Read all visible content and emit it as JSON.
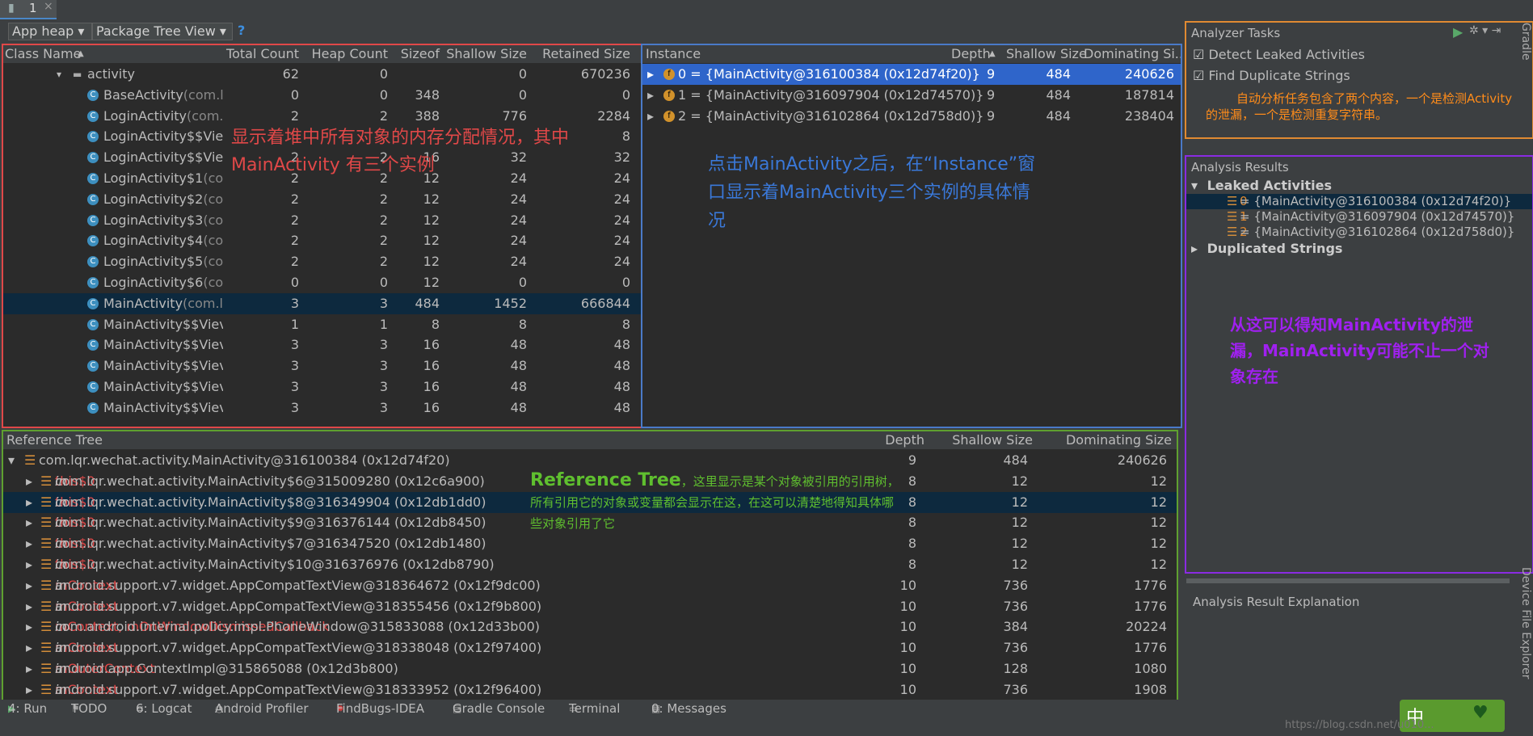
{
  "tab": {
    "label": "1",
    "close": "×"
  },
  "toolbar": {
    "heap": "App heap",
    "view": "Package Tree View",
    "help": "?"
  },
  "class_table": {
    "headers": [
      "Class Name",
      "Total Count",
      "Heap Count",
      "Sizeof",
      "Shallow Size",
      "Retained Size"
    ],
    "rows": [
      {
        "name": "activity",
        "pkg": "",
        "total": "62",
        "heap": "0",
        "sizeof": "",
        "shallow": "0",
        "retained": "670236"
      },
      {
        "name": "BaseActivity",
        "pkg": "(com.l",
        "total": "0",
        "heap": "0",
        "sizeof": "348",
        "shallow": "0",
        "retained": "0"
      },
      {
        "name": "LoginActivity",
        "pkg": "(com.",
        "total": "2",
        "heap": "2",
        "sizeof": "388",
        "shallow": "776",
        "retained": "2284"
      },
      {
        "name": "LoginActivity$$Viev",
        "pkg": "",
        "total": "",
        "heap": "",
        "sizeof": "",
        "shallow": "",
        "retained": "8"
      },
      {
        "name": "LoginActivity$$Viev",
        "pkg": "",
        "total": "2",
        "heap": "2",
        "sizeof": "16",
        "shallow": "32",
        "retained": "32"
      },
      {
        "name": "LoginActivity$1",
        "pkg": "(co",
        "total": "2",
        "heap": "2",
        "sizeof": "12",
        "shallow": "24",
        "retained": "24"
      },
      {
        "name": "LoginActivity$2",
        "pkg": "(co",
        "total": "2",
        "heap": "2",
        "sizeof": "12",
        "shallow": "24",
        "retained": "24"
      },
      {
        "name": "LoginActivity$3",
        "pkg": "(co",
        "total": "2",
        "heap": "2",
        "sizeof": "12",
        "shallow": "24",
        "retained": "24"
      },
      {
        "name": "LoginActivity$4",
        "pkg": "(co",
        "total": "2",
        "heap": "2",
        "sizeof": "12",
        "shallow": "24",
        "retained": "24"
      },
      {
        "name": "LoginActivity$5",
        "pkg": "(co",
        "total": "2",
        "heap": "2",
        "sizeof": "12",
        "shallow": "24",
        "retained": "24"
      },
      {
        "name": "LoginActivity$6",
        "pkg": "(co",
        "total": "0",
        "heap": "0",
        "sizeof": "12",
        "shallow": "0",
        "retained": "0"
      },
      {
        "name": "MainActivity",
        "pkg": "(com.l",
        "total": "3",
        "heap": "3",
        "sizeof": "484",
        "shallow": "1452",
        "retained": "666844"
      },
      {
        "name": "MainActivity$$Viev",
        "pkg": "",
        "total": "1",
        "heap": "1",
        "sizeof": "8",
        "shallow": "8",
        "retained": "8"
      },
      {
        "name": "MainActivity$$Viev",
        "pkg": "",
        "total": "3",
        "heap": "3",
        "sizeof": "16",
        "shallow": "48",
        "retained": "48"
      },
      {
        "name": "MainActivity$$Viev",
        "pkg": "",
        "total": "3",
        "heap": "3",
        "sizeof": "16",
        "shallow": "48",
        "retained": "48"
      },
      {
        "name": "MainActivity$$Viev",
        "pkg": "",
        "total": "3",
        "heap": "3",
        "sizeof": "16",
        "shallow": "48",
        "retained": "48"
      },
      {
        "name": "MainActivity$$Viev",
        "pkg": "",
        "total": "3",
        "heap": "3",
        "sizeof": "16",
        "shallow": "48",
        "retained": "48"
      }
    ]
  },
  "instance_table": {
    "headers": [
      "Instance",
      "Depth",
      "Shallow Size",
      "Dominating Si.."
    ],
    "rows": [
      {
        "label": "0 = {MainActivity@316100384 (0x12d74f20)}",
        "depth": "9",
        "shallow": "484",
        "dom": "240626"
      },
      {
        "label": "1 = {MainActivity@316097904 (0x12d74570)}",
        "depth": "9",
        "shallow": "484",
        "dom": "187814"
      },
      {
        "label": "2 = {MainActivity@316102864 (0x12d758d0)}",
        "depth": "9",
        "shallow": "484",
        "dom": "238404"
      }
    ]
  },
  "analyzer": {
    "title": "Analyzer Tasks",
    "tasks": [
      "Detect Leaked Activities",
      "Find Duplicate Strings"
    ],
    "results_title": "Analysis Results",
    "leaked_title": "Leaked Activities",
    "leaked": [
      "0 = {MainActivity@316100384 (0x12d74f20)}",
      "1 = {MainActivity@316097904 (0x12d74570)}",
      "2 = {MainActivity@316102864 (0x12d758d0)}"
    ],
    "duplicated_title": "Duplicated Strings",
    "explanation_title": "Analysis Result Explanation"
  },
  "reference_tree": {
    "headers": [
      "Reference Tree",
      "Depth",
      "Shallow Size",
      "Dominating Size"
    ],
    "rows": [
      {
        "field": "",
        "in": "",
        "obj": "com.lqr.wechat.activity.MainActivity@316100384 (0x12d74f20)",
        "depth": "9",
        "shallow": "484",
        "dom": "240626"
      },
      {
        "field": "this$0",
        "in": "in",
        "obj": "com.lqr.wechat.activity.MainActivity$6@315009280 (0x12c6a900)",
        "depth": "8",
        "shallow": "12",
        "dom": "12"
      },
      {
        "field": "this$0",
        "in": "in",
        "obj": "com.lqr.wechat.activity.MainActivity$8@316349904 (0x12db1dd0)",
        "depth": "8",
        "shallow": "12",
        "dom": "12"
      },
      {
        "field": "this$0",
        "in": "in",
        "obj": "com.lqr.wechat.activity.MainActivity$9@316376144 (0x12db8450)",
        "depth": "8",
        "shallow": "12",
        "dom": "12"
      },
      {
        "field": "this$0",
        "in": "in",
        "obj": "com.lqr.wechat.activity.MainActivity$7@316347520 (0x12db1480)",
        "depth": "8",
        "shallow": "12",
        "dom": "12"
      },
      {
        "field": "this$0",
        "in": "in",
        "obj": "com.lqr.wechat.activity.MainActivity$10@316376976 (0x12db8790)",
        "depth": "8",
        "shallow": "12",
        "dom": "12"
      },
      {
        "field": "mContext",
        "in": "in",
        "obj": "android.support.v7.widget.AppCompatTextView@318364672 (0x12f9dc00)",
        "depth": "10",
        "shallow": "736",
        "dom": "1776"
      },
      {
        "field": "mContext",
        "in": "in",
        "obj": "android.support.v7.widget.AppCompatTextView@318355456 (0x12f9b800)",
        "depth": "10",
        "shallow": "736",
        "dom": "1776"
      },
      {
        "field": "mContext, mOnWindowDismissedCallback",
        "in": "in",
        "obj": "com.android.internal.policy.impl.PhoneWindow@315833088 (0x12d33b00)",
        "depth": "10",
        "shallow": "384",
        "dom": "20224"
      },
      {
        "field": "mContext",
        "in": "in",
        "obj": "android.support.v7.widget.AppCompatTextView@318338048 (0x12f97400)",
        "depth": "10",
        "shallow": "736",
        "dom": "1776"
      },
      {
        "field": "mOuterContext",
        "in": "in",
        "obj": "android.app.ContextImpl@315865088 (0x12d3b800)",
        "depth": "10",
        "shallow": "128",
        "dom": "1080"
      },
      {
        "field": "mContext",
        "in": "in",
        "obj": "android.support.v7.widget.AppCompatTextView@318333952 (0x12f96400)",
        "depth": "10",
        "shallow": "736",
        "dom": "1908"
      }
    ]
  },
  "annotations": {
    "red": "显示着堆中所有对象的内存分配情况，其中MainActivity 有三个实例",
    "blue": "点击MainActivity之后，在“Instance”窗口显示着MainActivity三个实例的具体情况",
    "orange": "自动分析任务包含了两个内容，一个是检测Activity的泄漏，一个是检测重复字符串。",
    "purple": "从这可以得知MainActivity的泄漏，MainActivity可能不止一个对象存在",
    "green_title": "Reference Tree",
    "green": "，这里显示是某个对象被引用的引用树，所有引用它的对象或变量都会显示在这，在这可以清楚地得知具体哪些对象引用了它"
  },
  "bottom_bar": [
    "4: Run",
    "TODO",
    "6: Logcat",
    "Android Profiler",
    "FindBugs-IDEA",
    "Gradle Console",
    "Terminal",
    "0: Messages"
  ],
  "side_labels": {
    "gradle": "Gradle",
    "device": "Device File Explorer"
  },
  "ime": {
    "label": "中"
  },
  "watermark": "https://blog.csdn.net/u010..."
}
